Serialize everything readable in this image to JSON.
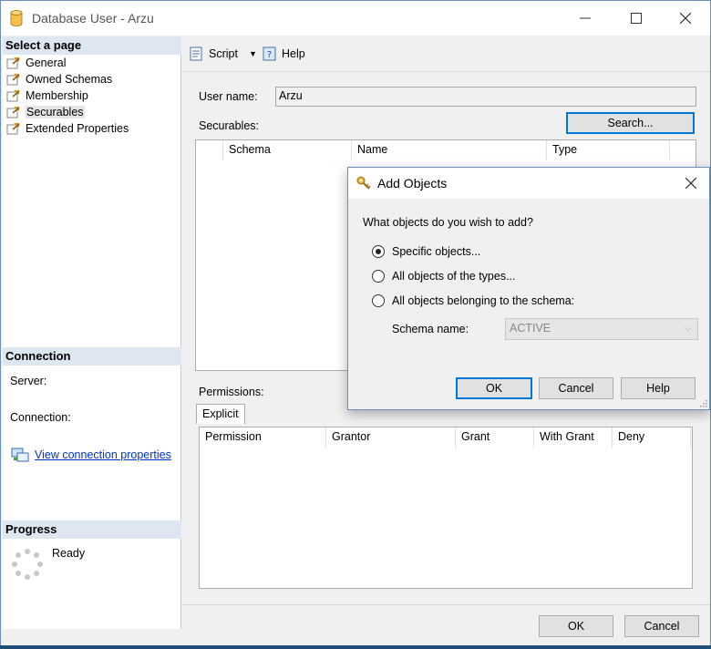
{
  "window": {
    "title": "Database User - Arzu"
  },
  "left": {
    "select_page_header": "Select a page",
    "pages": [
      {
        "label": "General",
        "selected": false
      },
      {
        "label": "Owned Schemas",
        "selected": false
      },
      {
        "label": "Membership",
        "selected": false
      },
      {
        "label": "Securables",
        "selected": true
      },
      {
        "label": "Extended Properties",
        "selected": false
      }
    ],
    "connection_header": "Connection",
    "server_label": "Server:",
    "connection_label": "Connection:",
    "view_connection_link": "View connection properties",
    "progress_header": "Progress",
    "progress_status": "Ready"
  },
  "toolbar": {
    "script_label": "Script",
    "help_label": "Help"
  },
  "form": {
    "user_name_label": "User name:",
    "user_name_value": "Arzu",
    "securables_label": "Securables:",
    "search_button": "Search...",
    "securables_columns": [
      "Schema",
      "Name",
      "Type"
    ],
    "permissions_label": "Permissions:",
    "permissions_tab": "Explicit",
    "permissions_columns": [
      "Permission",
      "Grantor",
      "Grant",
      "With Grant",
      "Deny"
    ]
  },
  "footer": {
    "ok_label": "OK",
    "cancel_label": "Cancel"
  },
  "dialog": {
    "title": "Add Objects",
    "question": "What objects do you wish to add?",
    "options": [
      {
        "label": "Specific objects...",
        "checked": true
      },
      {
        "label": "All objects of the types...",
        "checked": false
      },
      {
        "label": "All objects belonging to the schema:",
        "checked": false
      }
    ],
    "schema_name_label": "Schema name:",
    "schema_name_value": "ACTIVE",
    "ok_label": "OK",
    "cancel_label": "Cancel",
    "help_label": "Help"
  },
  "colors": {
    "accent": "#0078d7",
    "section_header": "#dde6f1",
    "link": "#0033cc"
  }
}
